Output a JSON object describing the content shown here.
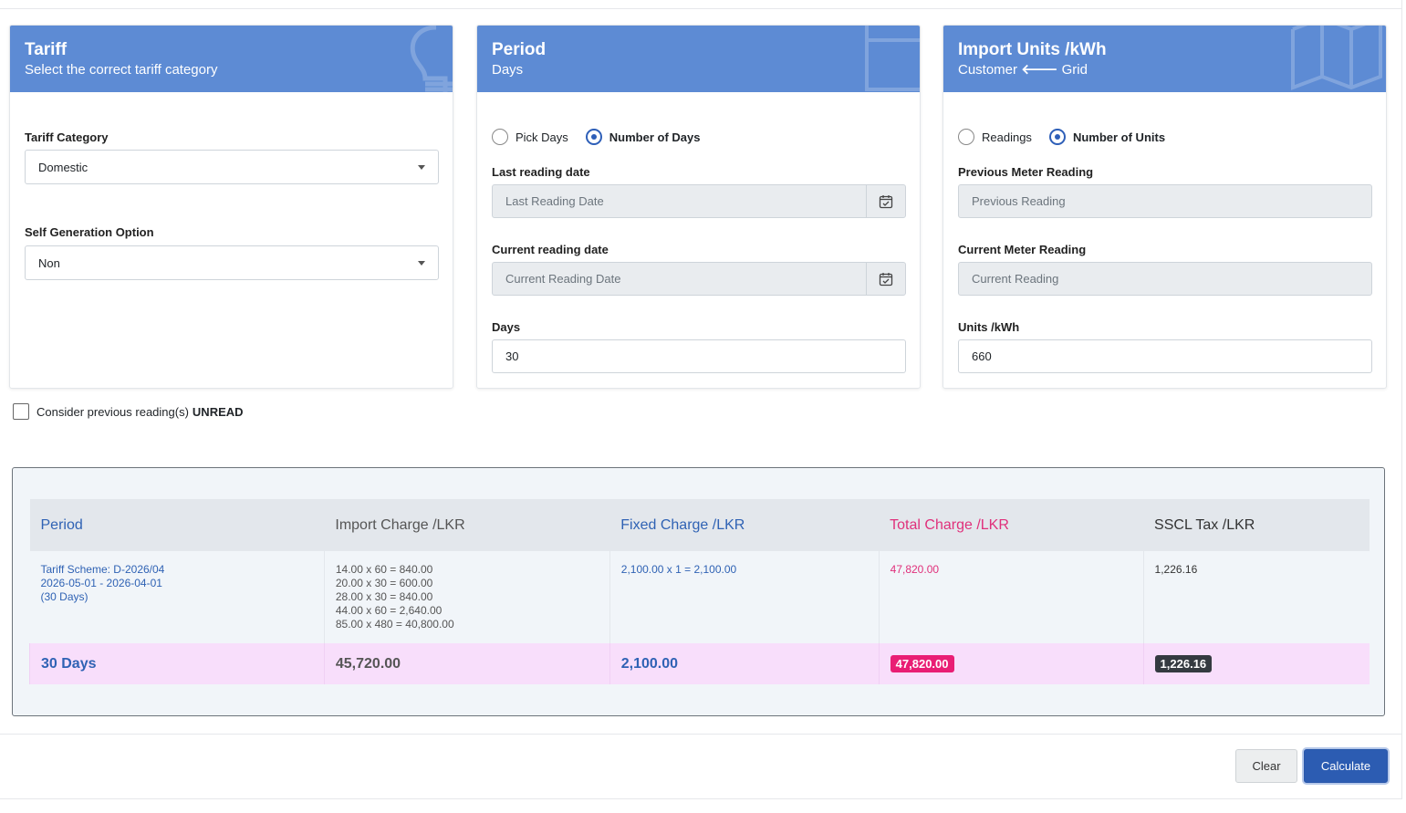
{
  "tariff_card": {
    "title": "Tariff",
    "subtitle": "Select the correct tariff category",
    "category_label": "Tariff Category",
    "category_value": "Domestic",
    "selfgen_label": "Self Generation Option",
    "selfgen_value": "Non"
  },
  "period_card": {
    "title": "Period",
    "subtitle": "Days",
    "radio_pick": "Pick Days",
    "radio_number": "Number of Days",
    "last_label": "Last reading date",
    "last_placeholder": "Last Reading Date",
    "current_label": "Current reading date",
    "current_placeholder": "Current Reading Date",
    "days_label": "Days",
    "days_value": "30"
  },
  "units_card": {
    "title": "Import Units /kWh",
    "subtitle_from": "Customer",
    "subtitle_arrow": "🡐",
    "subtitle_to": "Grid",
    "radio_readings": "Readings",
    "radio_units": "Number of Units",
    "prev_label": "Previous Meter Reading",
    "prev_placeholder": "Previous Reading",
    "curr_label": "Current Meter Reading",
    "curr_placeholder": "Current Reading",
    "units_label": "Units /kWh",
    "units_value": "660"
  },
  "unread": {
    "label": "Consider previous reading(s)",
    "emphasis": "UNREAD"
  },
  "results": {
    "headers": {
      "period": "Period",
      "import": "Import Charge /LKR",
      "fixed": "Fixed Charge /LKR",
      "total": "Total Charge /LKR",
      "sscl": "SSCL Tax /LKR"
    },
    "detail": {
      "scheme": "Tariff Scheme: D-2026/04",
      "dates": "2026-05-01 - 2026-04-01",
      "days": "(30 Days)",
      "import_lines": [
        "14.00 x 60 = 840.00",
        "20.00 x 30 = 600.00",
        "28.00 x 30 = 840.00",
        "44.00 x 60 = 2,640.00",
        "85.00 x 480 = 40,800.00"
      ],
      "fixed": "2,100.00 x 1 = 2,100.00",
      "total": "47,820.00",
      "sscl": "1,226.16"
    },
    "totals": {
      "period": "30 Days",
      "import": "45,720.00",
      "fixed": "2,100.00",
      "total": "47,820.00",
      "sscl": "1,226.16"
    }
  },
  "actions": {
    "clear": "Clear",
    "calculate": "Calculate"
  },
  "colors": {
    "header_blue": "#5d8bd4",
    "primary": "#2c5cb2",
    "pink": "#e91e74",
    "total_row": "#f8defb"
  }
}
